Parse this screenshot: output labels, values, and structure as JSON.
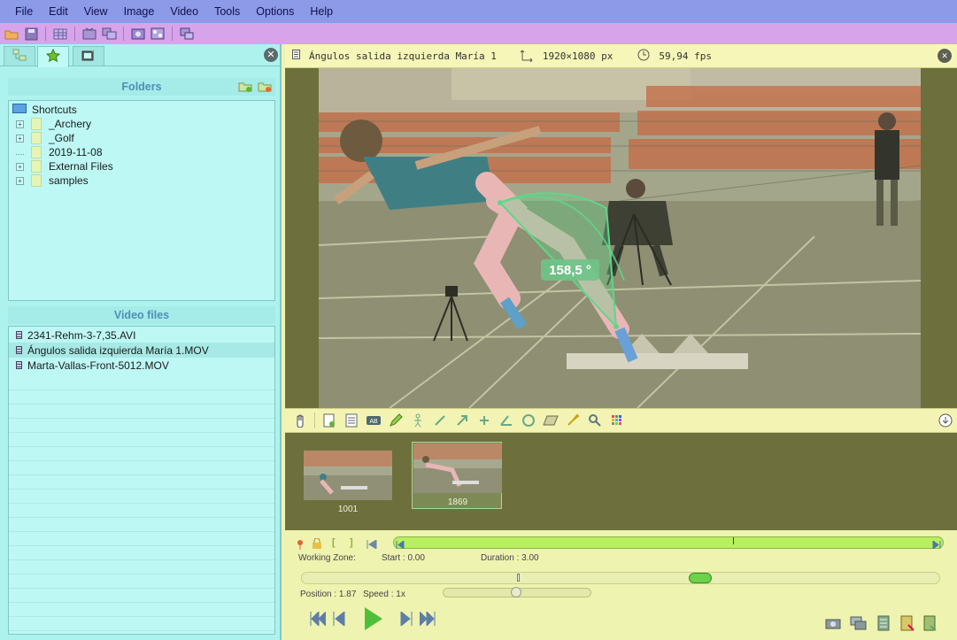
{
  "menu": [
    "File",
    "Edit",
    "View",
    "Image",
    "Video",
    "Tools",
    "Options",
    "Help"
  ],
  "left_panel": {
    "folders_title": "Folders",
    "tree": {
      "root": "Shortcuts",
      "items": [
        "_Archery",
        "_Golf",
        "2019-11-08",
        "External Files",
        "samples"
      ]
    },
    "video_files_title": "Video files",
    "files": [
      "2341-Rehm-3-7,35.AVI",
      "Ángulos salida izquierda María 1.MOV",
      "Marta-Vallas-Front-5012.MOV"
    ]
  },
  "video": {
    "title": "Ángulos salida izquierda María 1",
    "resolution": "1920×1080 px",
    "fps": "59,94 fps",
    "angle_label": "158,5 °"
  },
  "keyframes": [
    "1001",
    "1869"
  ],
  "player": {
    "working_zone_label": "Working Zone:",
    "start": "Start : 0.00",
    "duration": "Duration : 3.00",
    "position": "Position : 1.87",
    "speed": "Speed : 1x"
  },
  "colors": {
    "menubar": "#8c9ae8",
    "toolbar": "#d7a4ec",
    "left_panel": "#aef2ee",
    "right_bg": "#f2f2b0",
    "video_bg": "#6d6f3c",
    "angle_green": "#5fd68a"
  }
}
